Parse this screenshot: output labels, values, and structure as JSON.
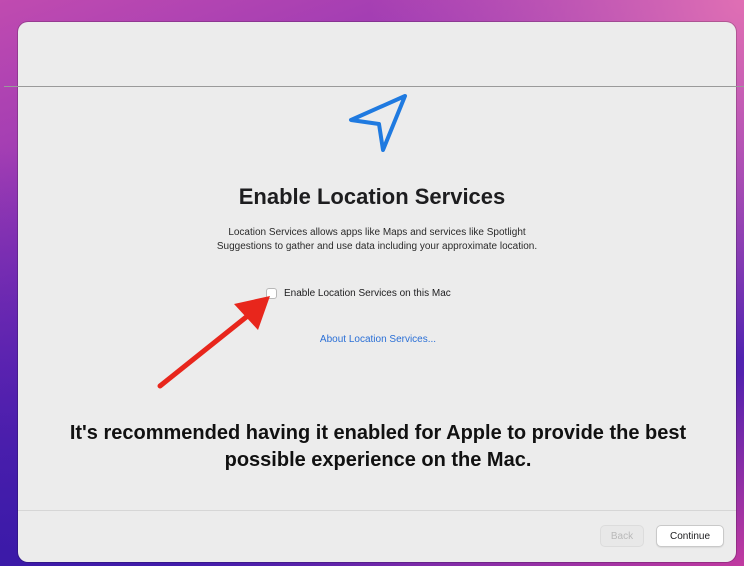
{
  "setup": {
    "title": "Enable Location Services",
    "description_line1": "Location Services allows apps like Maps and services like Spotlight",
    "description_line2": "Suggestions to gather and use data including your approximate location.",
    "checkbox_label": "Enable Location Services on this Mac",
    "checkbox_checked": false,
    "about_link": "About Location Services..."
  },
  "annotation": {
    "caption_line1": "It's recommended having it enabled for Apple to provide the best",
    "caption_line2": "possible experience on the Mac.",
    "arrow_color": "#e8261c"
  },
  "footer": {
    "back_label": "Back",
    "back_enabled": false,
    "continue_label": "Continue"
  },
  "icons": {
    "location": "location-arrow-icon"
  },
  "colors": {
    "accent": "#1f7ae0",
    "link": "#2a6fd6",
    "window_bg": "#ececec"
  }
}
